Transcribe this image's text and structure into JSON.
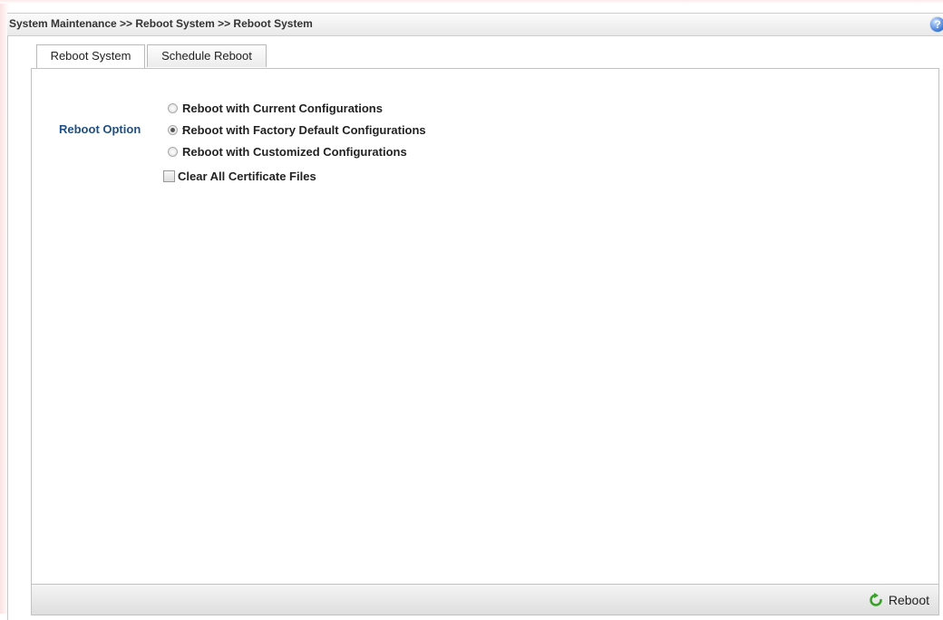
{
  "header": {
    "breadcrumb": "System Maintenance >> Reboot System >> Reboot System",
    "help_icon": "question-mark-circle"
  },
  "tabs": [
    {
      "label": "Reboot System",
      "active": true
    },
    {
      "label": "Schedule Reboot",
      "active": false
    }
  ],
  "form": {
    "option_label": "Reboot Option",
    "option_colon": ":",
    "options": [
      {
        "label": "Reboot with Current Configurations",
        "checked": false
      },
      {
        "label": "Reboot with Factory Default Configurations",
        "checked": true
      },
      {
        "label": "Reboot with Customized Configurations",
        "checked": false
      }
    ],
    "checkbox": {
      "label": "Clear All Certificate Files",
      "checked": false
    }
  },
  "footer": {
    "button_label": "Reboot",
    "button_icon": "refresh-icon",
    "button_icon_color": "#3aa12b"
  }
}
